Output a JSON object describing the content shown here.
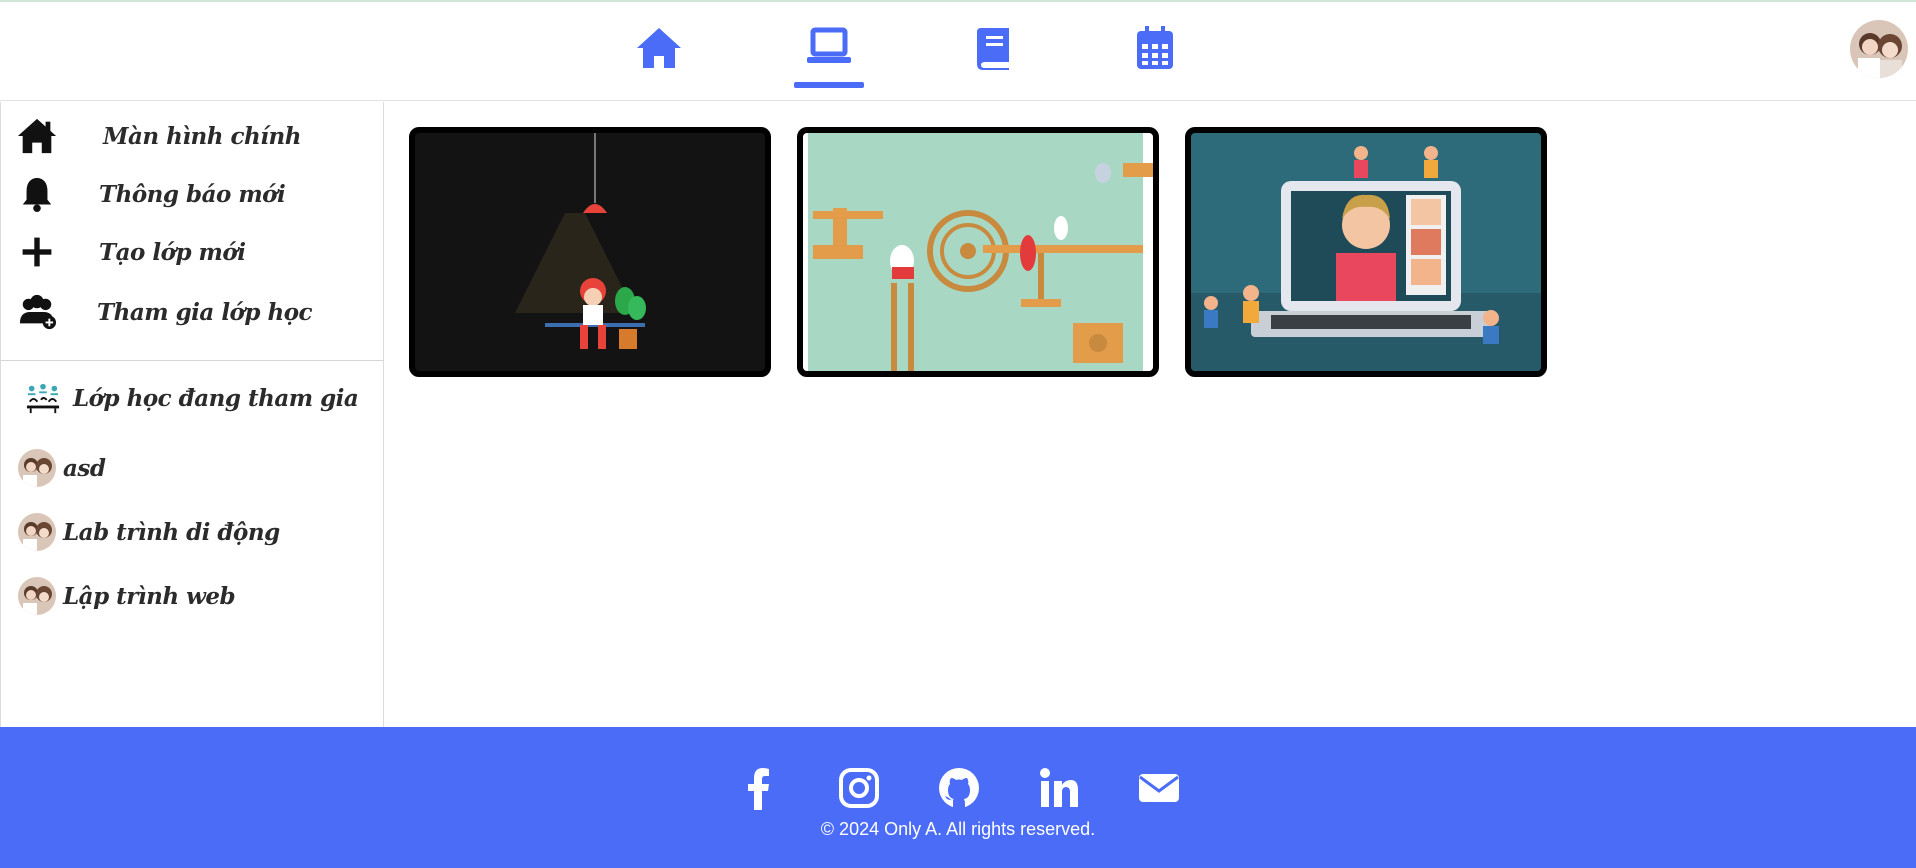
{
  "nav": {
    "items": [
      {
        "name": "home",
        "icon": "home-icon",
        "active": false
      },
      {
        "name": "classroom",
        "icon": "laptop-icon",
        "active": true
      },
      {
        "name": "book",
        "icon": "book-icon",
        "active": false
      },
      {
        "name": "calendar",
        "icon": "calendar-icon",
        "active": false
      }
    ],
    "accent": "#4a6cf7"
  },
  "sidebar": {
    "menu": [
      {
        "label": "Màn hình chính",
        "icon": "home-icon"
      },
      {
        "label": "Thông báo mới",
        "icon": "bell-icon"
      },
      {
        "label": "Tạo lớp mới",
        "icon": "plus-icon"
      },
      {
        "label": "Tham gia lớp học",
        "icon": "users-add-icon"
      }
    ],
    "joined_header": {
      "label": "Lớp học đang tham gia",
      "icon": "classroom-icon"
    },
    "classes": [
      {
        "label": "asd"
      },
      {
        "label": "Lab trình di động"
      },
      {
        "label": "Lập trình web"
      }
    ]
  },
  "cards": [
    {
      "name": "card-lamp-study",
      "theme": "#111111"
    },
    {
      "name": "card-penguin-machine",
      "theme": "#a8d8c4"
    },
    {
      "name": "card-online-class",
      "theme": "#2d6b7a"
    }
  ],
  "footer": {
    "socials": [
      "facebook-icon",
      "instagram-icon",
      "github-icon",
      "linkedin-icon",
      "email-icon"
    ],
    "copyright": "© 2024 Only A. All rights reserved.",
    "background": "#4a6cf7"
  }
}
